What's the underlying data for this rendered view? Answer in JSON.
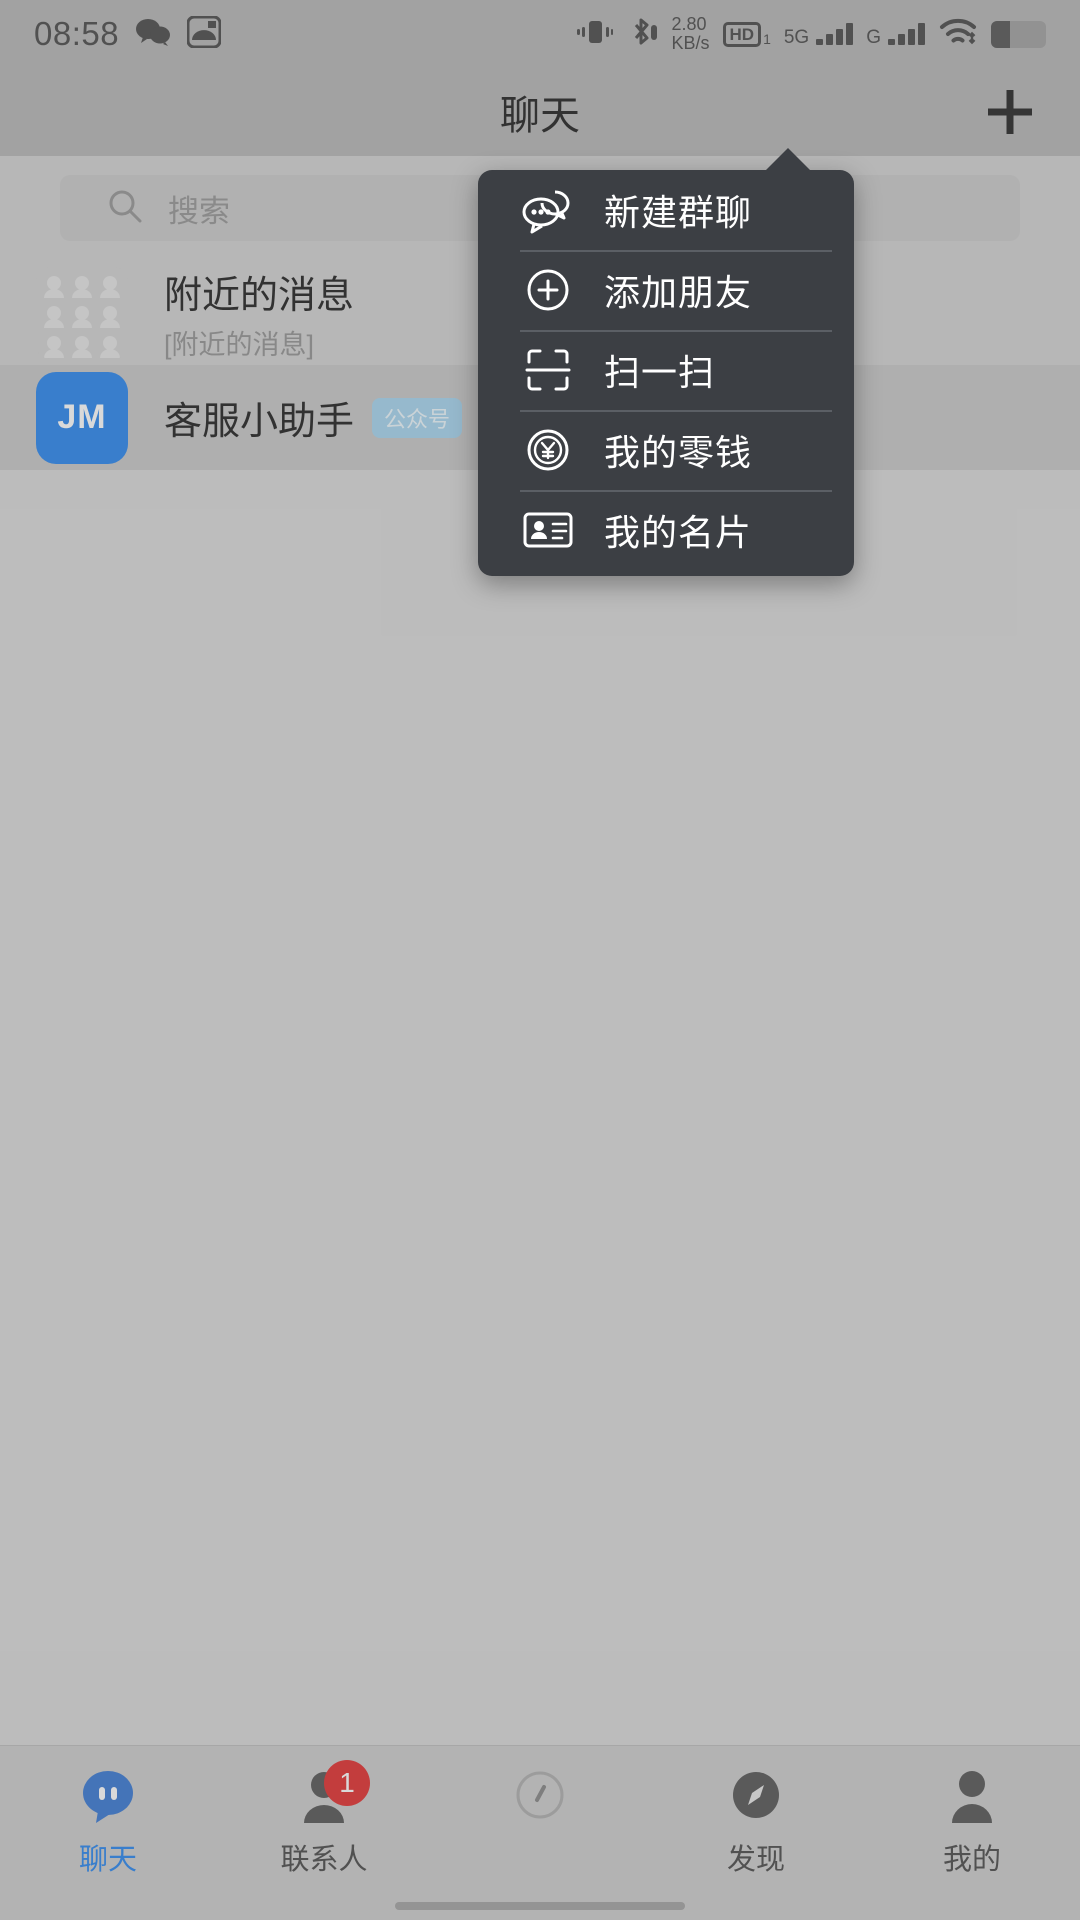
{
  "status_bar": {
    "time": "08:58",
    "left_icons": [
      "wechat-icon",
      "app-icon"
    ],
    "net_speed_value": "2.80",
    "net_speed_unit": "KB/s",
    "hd_label": "HD",
    "hd_sub": "1",
    "sim1_label": "5G",
    "sim2_label": "G",
    "right_icons": [
      "vibrate-icon",
      "bluetooth-icon",
      "hd-icon",
      "signal-5g-icon",
      "signal-g-icon",
      "wifi-icon",
      "battery-icon"
    ]
  },
  "header": {
    "title": "聊天",
    "plus_label": "+"
  },
  "search": {
    "placeholder": "搜索",
    "icon": "search-icon"
  },
  "chats": [
    {
      "title": "附近的消息",
      "subtitle": "[附近的消息]",
      "avatar_type": "group-avatar",
      "avatar_text": "",
      "tag": ""
    },
    {
      "title": "客服小助手",
      "subtitle": "",
      "avatar_type": "initials-avatar",
      "avatar_text": "JM",
      "tag": "公众号"
    }
  ],
  "popup_menu": {
    "items": [
      {
        "label": "新建群聊",
        "icon": "chat-bubbles-icon"
      },
      {
        "label": "添加朋友",
        "icon": "plus-circle-icon"
      },
      {
        "label": "扫一扫",
        "icon": "scan-icon"
      },
      {
        "label": "我的零钱",
        "icon": "yuan-coin-icon"
      },
      {
        "label": "我的名片",
        "icon": "id-card-icon"
      }
    ]
  },
  "bottom_nav": {
    "tabs": [
      {
        "label": "聊天",
        "icon": "chat-icon",
        "active": true,
        "badge": ""
      },
      {
        "label": "联系人",
        "icon": "contacts-icon",
        "active": false,
        "badge": "1"
      },
      {
        "label": "",
        "icon": "compass-ring-icon",
        "active": false,
        "badge": ""
      },
      {
        "label": "发现",
        "icon": "discover-icon",
        "active": false,
        "badge": ""
      },
      {
        "label": "我的",
        "icon": "profile-icon",
        "active": false,
        "badge": ""
      }
    ]
  },
  "colors": {
    "accent": "#1a7ded",
    "badge": "#e02020",
    "menu_bg": "#3c3f44",
    "tag_bg": "#9fd2ee"
  }
}
